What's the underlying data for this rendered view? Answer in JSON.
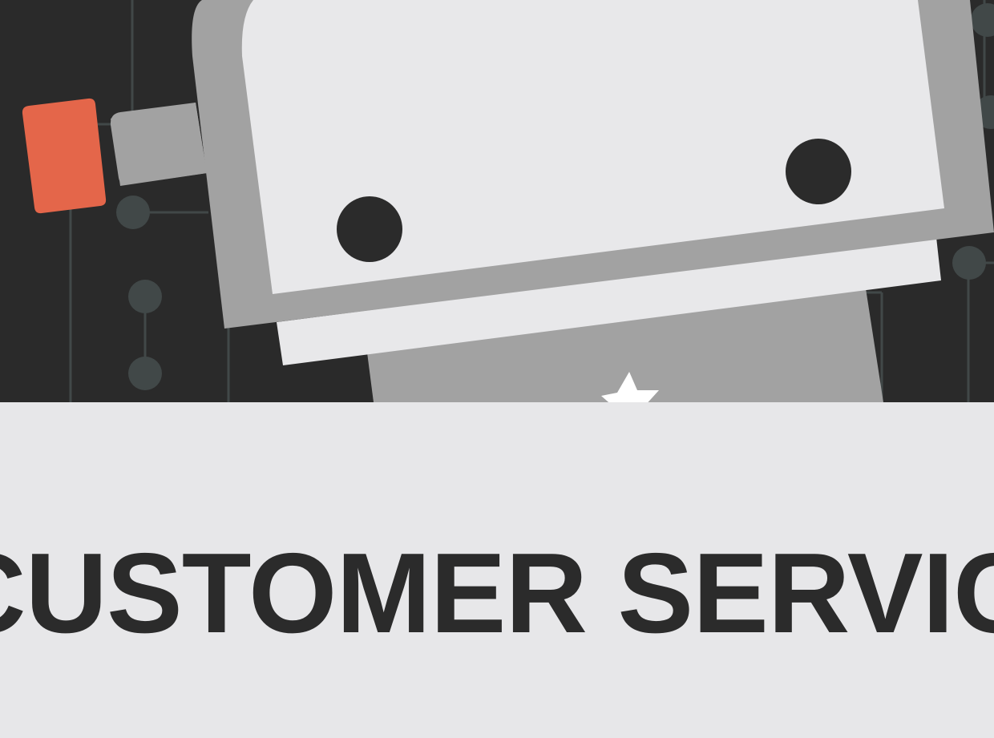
{
  "hero": {
    "illustration": "robot-customer-service",
    "colors": {
      "background": "#2a2a2a",
      "circuit": "#414848",
      "robot_light": "#e8e8ea",
      "robot_mid": "#a2a2a2",
      "robot_dark": "#2b2b2b",
      "accent": "#e4664a"
    },
    "icons": [
      "robot-head",
      "robot-eye",
      "star-icon",
      "flag-icon",
      "circuit-node"
    ]
  },
  "headline": {
    "text": "CUSTOMER SERVICE"
  }
}
